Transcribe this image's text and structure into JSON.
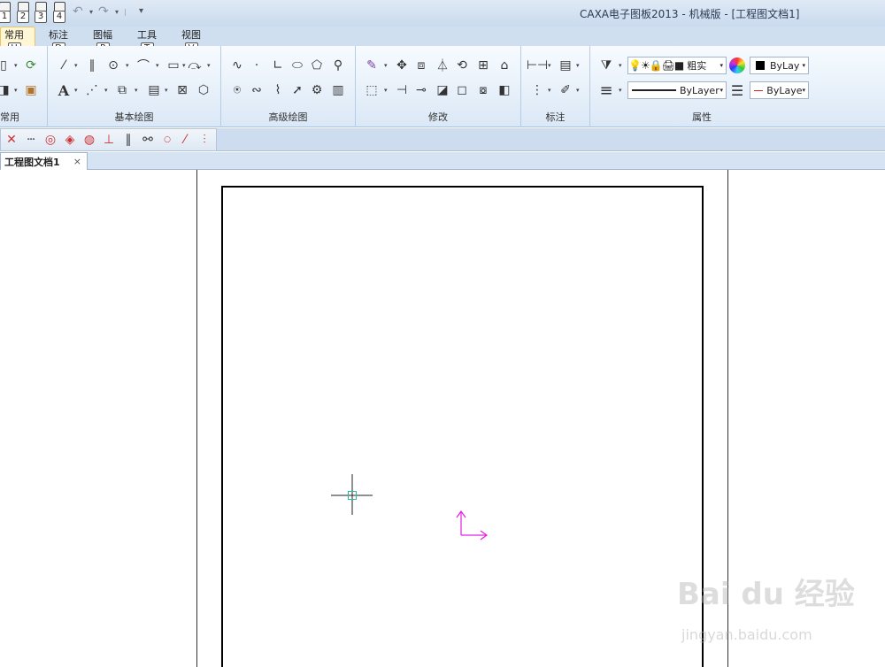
{
  "app": {
    "title": "CAXA电子图板2013 - 机械版 - [工程图文档1]"
  },
  "quick_access": {
    "keys": [
      "1",
      "2",
      "3",
      "4"
    ],
    "menu_arrow": "▾"
  },
  "ribbon_tabs": [
    {
      "label": "常用",
      "key": "U"
    },
    {
      "label": "标注",
      "key": "D"
    },
    {
      "label": "图幅",
      "key": "P"
    },
    {
      "label": "工具",
      "key": "T"
    },
    {
      "label": "视图",
      "key": "V"
    }
  ],
  "ribbon_groups": {
    "common": "常用",
    "basic_draw": "基本绘图",
    "advanced_draw": "高级绘图",
    "modify": "修改",
    "annotation": "标注",
    "properties": "属性"
  },
  "properties": {
    "layer_name": "粗实",
    "color_value": "ByLay",
    "linetype_value": "ByLayer",
    "lineweight_value": "ByLaye"
  },
  "document_tabs": [
    {
      "label": "工程图文档1",
      "close": "×"
    }
  ],
  "colors": {
    "ucs_axis": "#e020e0",
    "cursor_box": "#20c0a0",
    "ribbon_bg": "#dbe8f6",
    "title_bg": "#c9dbee"
  },
  "watermark": {
    "brand": "Bai du 经验",
    "url": "jingyan.baidu.com"
  }
}
